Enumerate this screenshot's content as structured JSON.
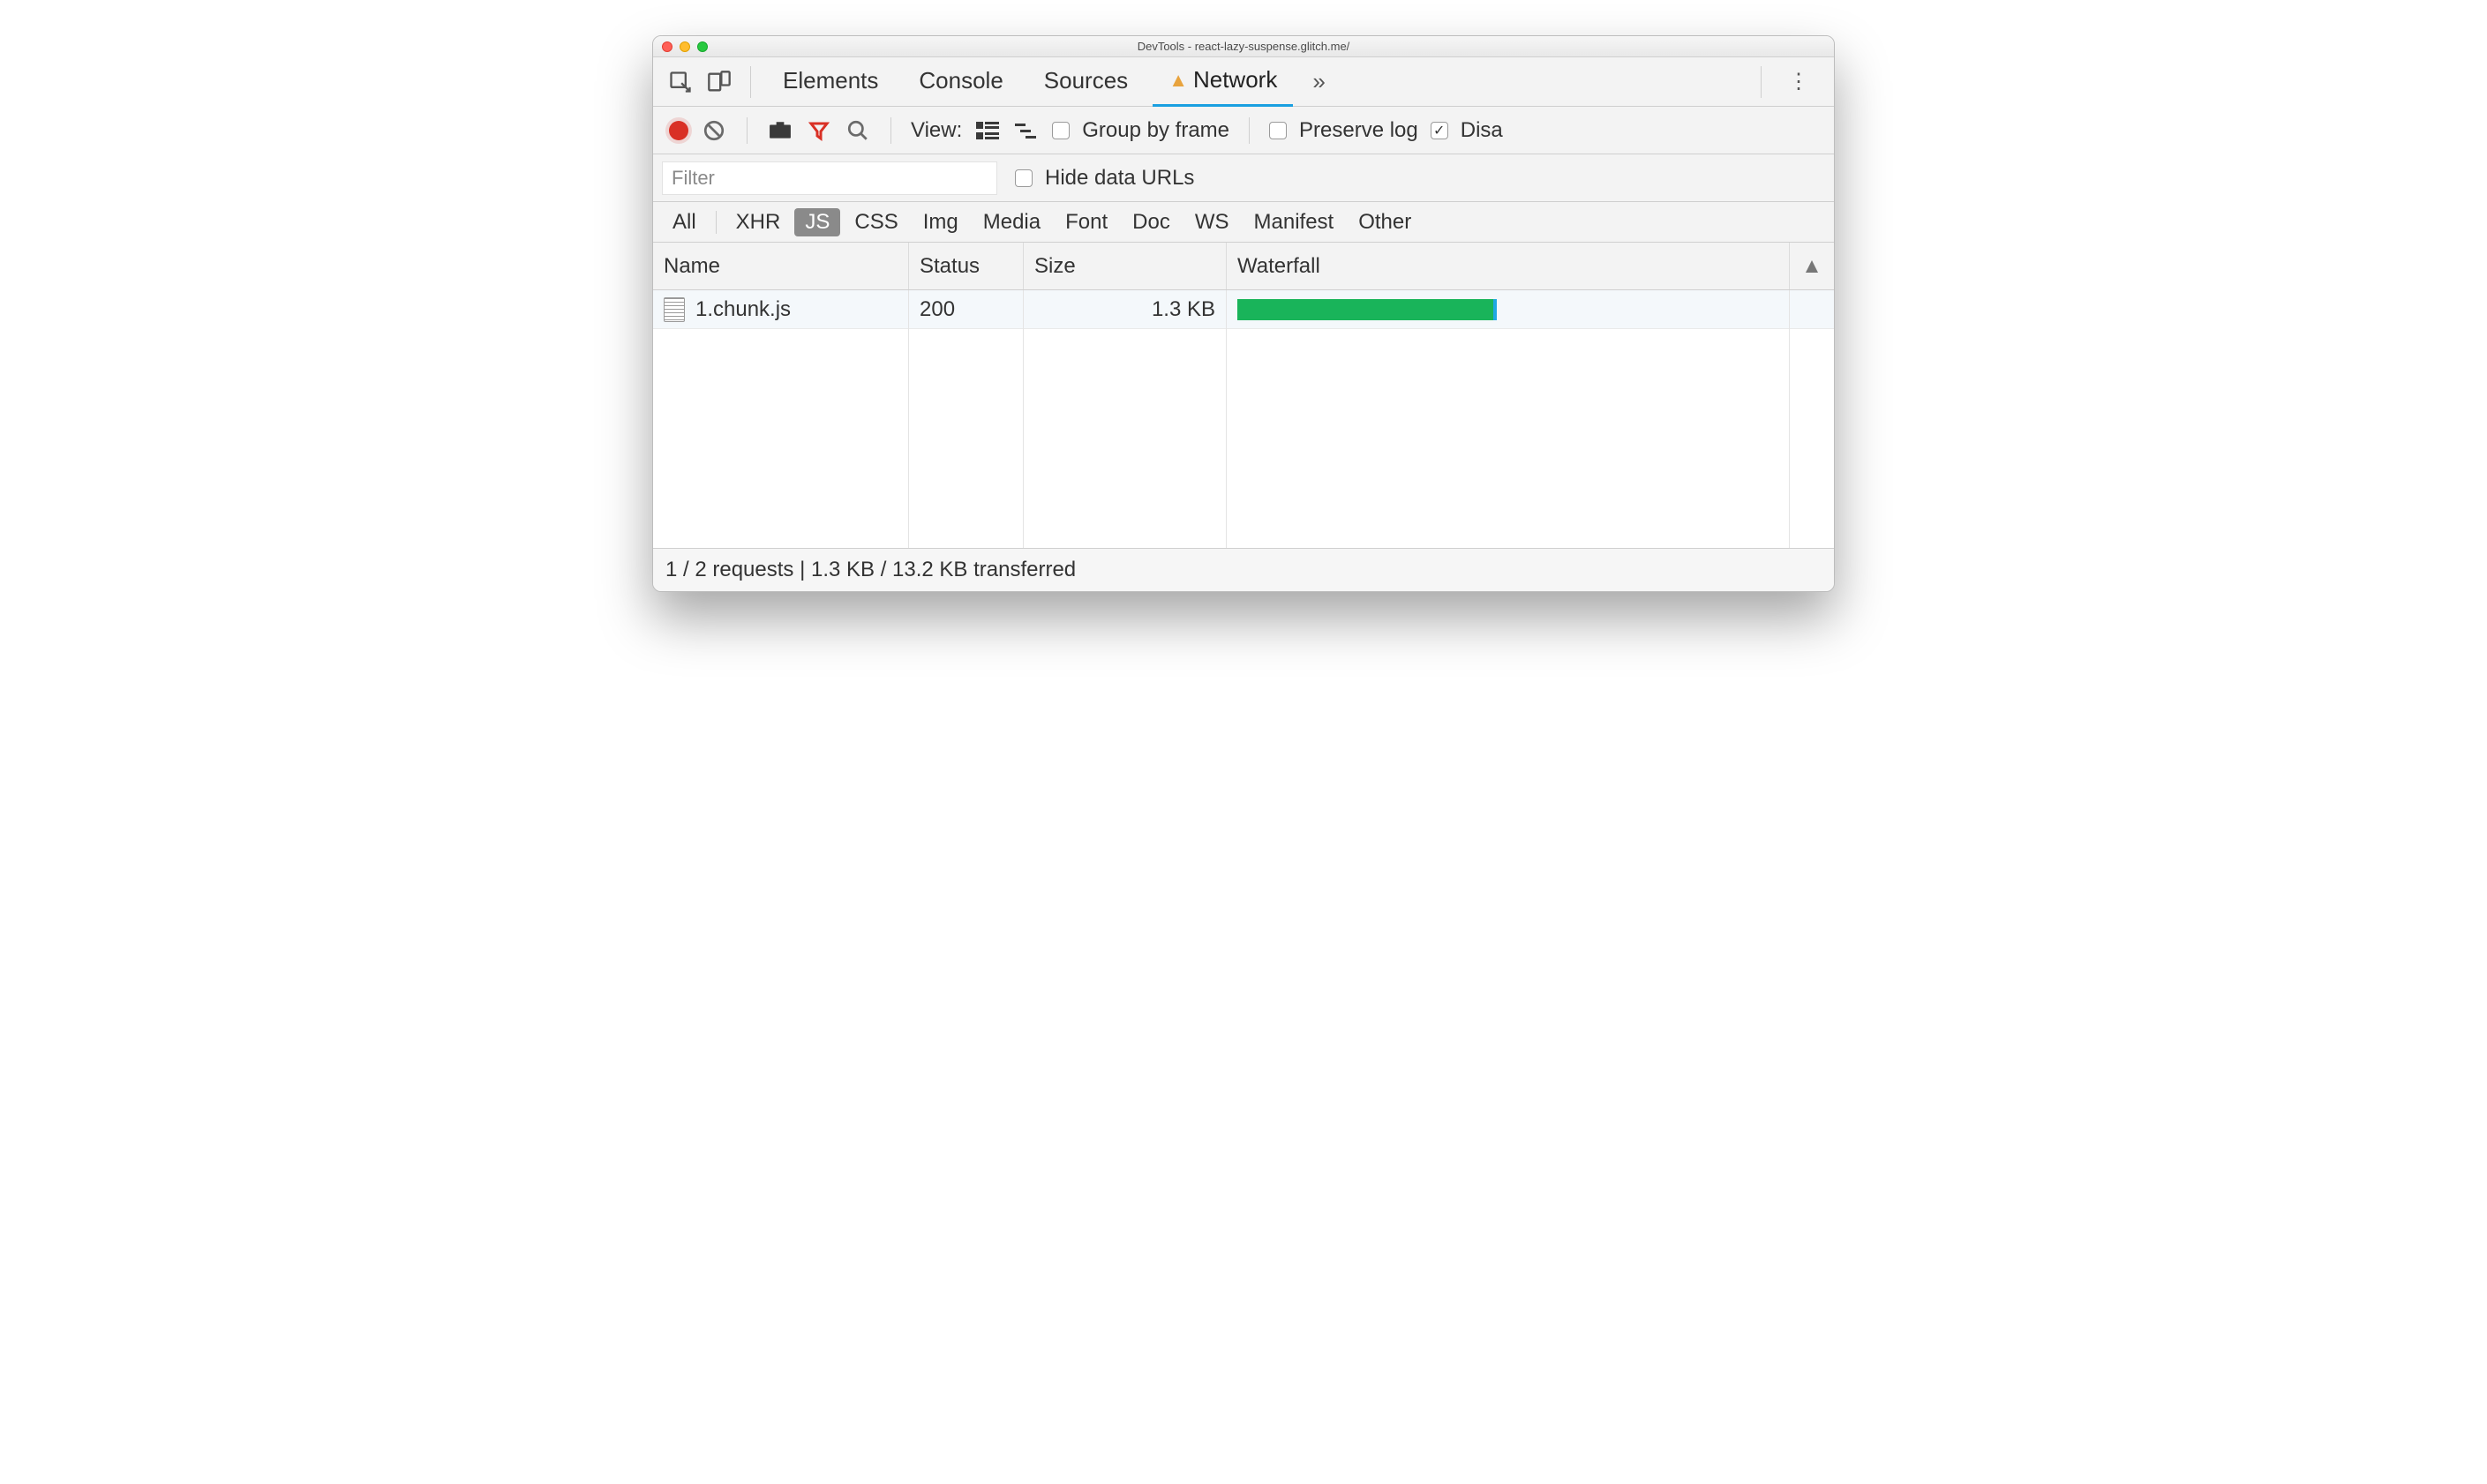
{
  "window": {
    "title": "DevTools - react-lazy-suspense.glitch.me/"
  },
  "tabs": {
    "items": [
      "Elements",
      "Console",
      "Sources",
      "Network"
    ],
    "active": "Network",
    "has_warning_on": "Network"
  },
  "toolbar": {
    "view_label": "View:",
    "group_label": "Group by frame",
    "preserve_label": "Preserve log",
    "disable_cache_label": "Disa",
    "group_checked": false,
    "preserve_checked": false,
    "disable_checked": true
  },
  "filter": {
    "placeholder": "Filter",
    "hide_label": "Hide data URLs",
    "hide_checked": false
  },
  "types": {
    "items": [
      "All",
      "XHR",
      "JS",
      "CSS",
      "Img",
      "Media",
      "Font",
      "Doc",
      "WS",
      "Manifest",
      "Other"
    ],
    "selected": "JS"
  },
  "table": {
    "headers": {
      "name": "Name",
      "status": "Status",
      "size": "Size",
      "waterfall": "Waterfall"
    },
    "rows": [
      {
        "name": "1.chunk.js",
        "status": "200",
        "size": "1.3 KB",
        "waterfall_pct": 48
      }
    ]
  },
  "statusbar": {
    "text": "1 / 2 requests | 1.3 KB / 13.2 KB transferred"
  }
}
